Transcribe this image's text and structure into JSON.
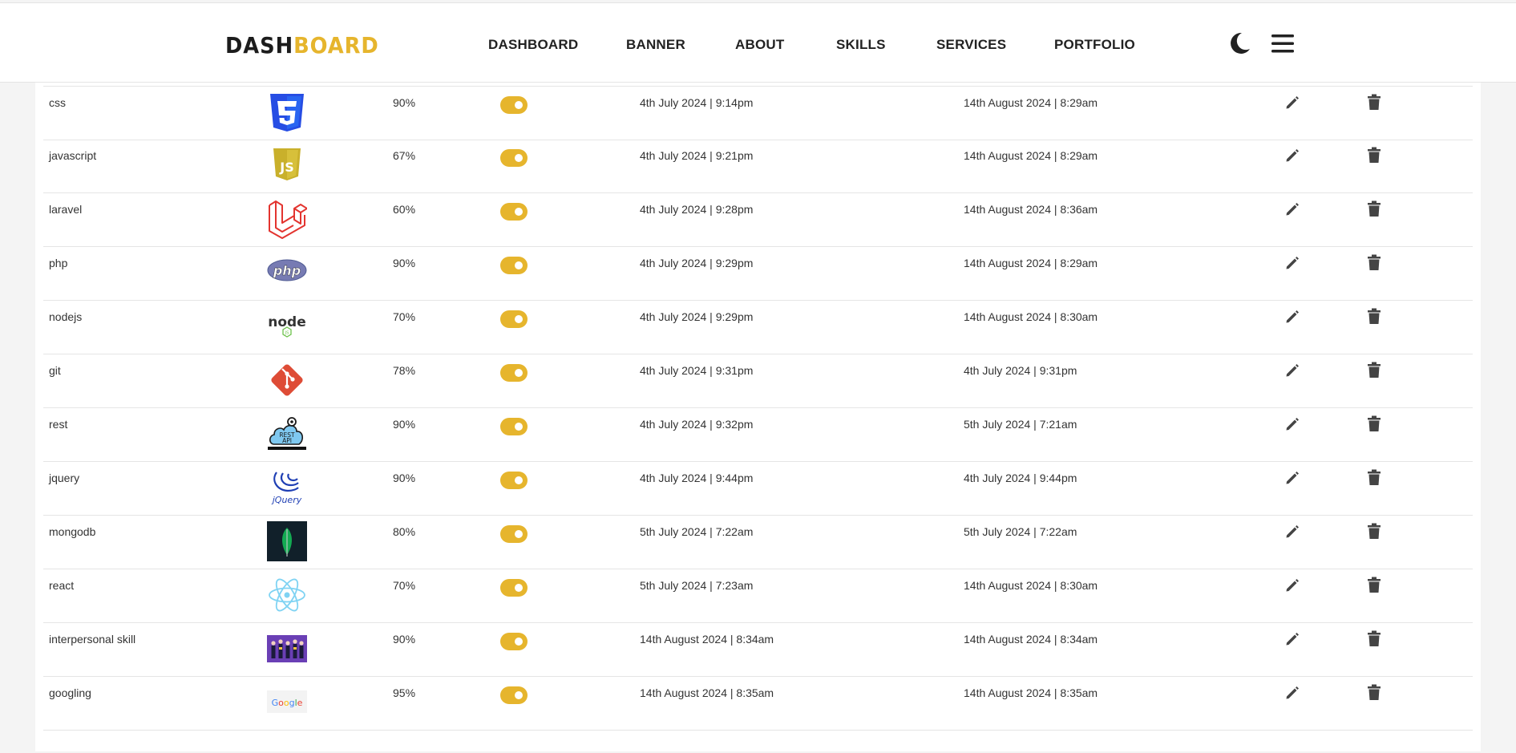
{
  "header": {
    "logo_part1": "DASH",
    "logo_part2": "BOARD",
    "nav": [
      "DASHBOARD",
      "BANNER",
      "ABOUT",
      "SKILLS",
      "SERVICES",
      "PORTFOLIO"
    ],
    "theme_icon": "moon-icon",
    "menu_icon": "hamburger-menu-icon"
  },
  "colors": {
    "accent": "#e6b52d",
    "text": "#333333",
    "background": "#f4f4f4"
  },
  "skills": [
    {
      "name": "css",
      "icon": "css3-logo",
      "percent": "90%",
      "active": true,
      "created": "4th July 2024 | 9:14pm",
      "updated": "14th August 2024 | 8:29am"
    },
    {
      "name": "javascript",
      "icon": "javascript-logo",
      "percent": "67%",
      "active": true,
      "created": "4th July 2024 | 9:21pm",
      "updated": "14th August 2024 | 8:29am"
    },
    {
      "name": "laravel",
      "icon": "laravel-logo",
      "percent": "60%",
      "active": true,
      "created": "4th July 2024 | 9:28pm",
      "updated": "14th August 2024 | 8:36am"
    },
    {
      "name": "php",
      "icon": "php-logo",
      "percent": "90%",
      "active": true,
      "created": "4th July 2024 | 9:29pm",
      "updated": "14th August 2024 | 8:29am"
    },
    {
      "name": "nodejs",
      "icon": "nodejs-logo",
      "percent": "70%",
      "active": true,
      "created": "4th July 2024 | 9:29pm",
      "updated": "14th August 2024 | 8:30am"
    },
    {
      "name": "git",
      "icon": "git-logo",
      "percent": "78%",
      "active": true,
      "created": "4th July 2024 | 9:31pm",
      "updated": "4th July 2024 | 9:31pm"
    },
    {
      "name": "rest",
      "icon": "rest-api-logo",
      "percent": "90%",
      "active": true,
      "created": "4th July 2024 | 9:32pm",
      "updated": "5th July 2024 | 7:21am"
    },
    {
      "name": "jquery",
      "icon": "jquery-logo",
      "percent": "90%",
      "active": true,
      "created": "4th July 2024 | 9:44pm",
      "updated": "4th July 2024 | 9:44pm"
    },
    {
      "name": "mongodb",
      "icon": "mongodb-logo",
      "percent": "80%",
      "active": true,
      "created": "5th July 2024 | 7:22am",
      "updated": "5th July 2024 | 7:22am"
    },
    {
      "name": "react",
      "icon": "react-logo",
      "percent": "70%",
      "active": true,
      "created": "5th July 2024 | 7:23am",
      "updated": "14th August 2024 | 8:30am"
    },
    {
      "name": "interpersonal skill",
      "icon": "people-illustration",
      "percent": "90%",
      "active": true,
      "created": "14th August 2024 | 8:34am",
      "updated": "14th August 2024 | 8:34am"
    },
    {
      "name": "googling",
      "icon": "google-logo",
      "percent": "95%",
      "active": true,
      "created": "14th August 2024 | 8:35am",
      "updated": "14th August 2024 | 8:35am"
    }
  ],
  "row_actions": {
    "edit_icon": "pencil-icon",
    "delete_icon": "trash-icon"
  }
}
